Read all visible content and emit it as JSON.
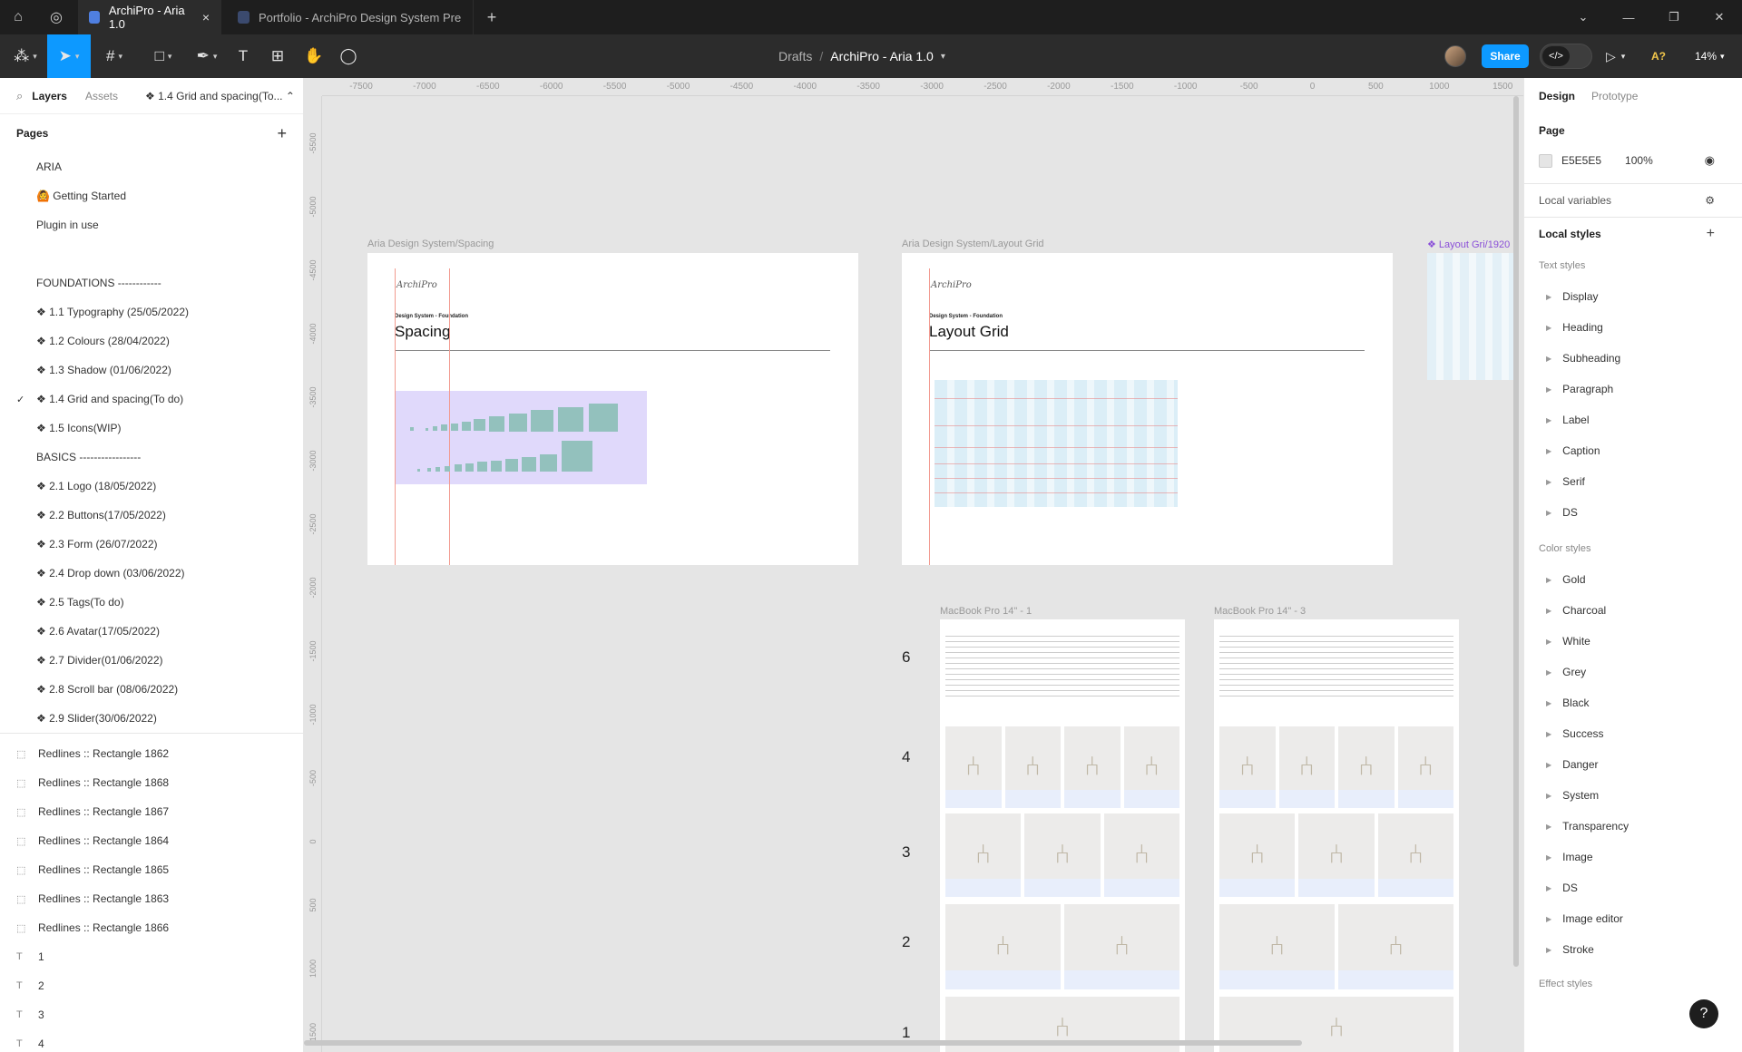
{
  "titlebar": {
    "tabs": [
      {
        "label": "ArchiPro - Aria 1.0",
        "close": "×"
      },
      {
        "label": "Portfolio - ArchiPro Design System Prepar"
      }
    ],
    "new_tab": "+",
    "window": {
      "minimize": "—",
      "maximize": "❐",
      "close": "✕",
      "dropdown": "⌄"
    }
  },
  "toolbar": {
    "breadcrumb": {
      "folder": "Drafts",
      "separator": "/",
      "file": "ArchiPro - Aria 1.0"
    },
    "share_label": "Share",
    "dev_label": "</>",
    "a11y_label": "A?",
    "zoom_label": "14%"
  },
  "left_panel": {
    "tabs": {
      "layers": "Layers",
      "assets": "Assets",
      "current_page": "❖ 1.4 Grid and spacing(To... ⌃"
    },
    "pages_header": "Pages",
    "pages": [
      {
        "label": "ARIA"
      },
      {
        "label": "🙆 Getting Started"
      },
      {
        "label": "Plugin in use"
      },
      {
        "label": ""
      },
      {
        "label": "FOUNDATIONS ------------"
      },
      {
        "label": "❖ 1.1 Typography (25/05/2022)"
      },
      {
        "label": "❖ 1.2 Colours (28/04/2022)"
      },
      {
        "label": "❖ 1.3 Shadow (01/06/2022)"
      },
      {
        "label": "❖ 1.4 Grid and spacing(To do)",
        "checked": "✓"
      },
      {
        "label": "❖ 1.5 Icons(WIP)"
      },
      {
        "label": "BASICS -----------------"
      },
      {
        "label": "❖ 2.1 Logo (18/05/2022)"
      },
      {
        "label": "❖ 2.2 Buttons(17/05/2022)"
      },
      {
        "label": "❖ 2.3 Form (26/07/2022)"
      },
      {
        "label": "❖ 2.4 Drop down (03/06/2022)"
      },
      {
        "label": "❖ 2.5 Tags(To do)"
      },
      {
        "label": "❖ 2.6 Avatar(17/05/2022)"
      },
      {
        "label": "❖ 2.7 Divider(01/06/2022)"
      },
      {
        "label": "❖ 2.8 Scroll bar (08/06/2022)"
      },
      {
        "label": "❖ 2.9 Slider(30/06/2022)"
      }
    ],
    "layers": [
      {
        "label": "Redlines :: Rectangle 1862",
        "icon": "⬚"
      },
      {
        "label": "Redlines :: Rectangle 1868",
        "icon": "⬚"
      },
      {
        "label": "Redlines :: Rectangle 1867",
        "icon": "⬚"
      },
      {
        "label": "Redlines :: Rectangle 1864",
        "icon": "⬚"
      },
      {
        "label": "Redlines :: Rectangle 1865",
        "icon": "⬚"
      },
      {
        "label": "Redlines :: Rectangle 1863",
        "icon": "⬚"
      },
      {
        "label": "Redlines :: Rectangle 1866",
        "icon": "⬚"
      },
      {
        "label": "1",
        "icon": "T"
      },
      {
        "label": "2",
        "icon": "T"
      },
      {
        "label": "3",
        "icon": "T"
      },
      {
        "label": "4",
        "icon": "T"
      }
    ]
  },
  "right_panel": {
    "tabs": {
      "design": "Design",
      "prototype": "Prototype"
    },
    "page_header": "Page",
    "page_fill": {
      "color": "E5E5E5",
      "opacity": "100%"
    },
    "local_variables": "Local variables",
    "local_styles": "Local styles",
    "text_styles_header": "Text styles",
    "text_styles": [
      "Display",
      "Heading",
      "Subheading",
      "Paragraph",
      "Label",
      "Caption",
      "Serif",
      "DS"
    ],
    "color_styles_header": "Color styles",
    "color_styles": [
      "Gold",
      "Charcoal",
      "White",
      "Grey",
      "Black",
      "Success",
      "Danger",
      "System",
      "Transparency",
      "Image",
      "DS",
      "Image editor",
      "Stroke"
    ],
    "effect_styles_header": "Effect styles"
  },
  "canvas": {
    "ruler_top": [
      "-7500",
      "-7000",
      "-6500",
      "-6000",
      "-5500",
      "-5000",
      "-4500",
      "-4000",
      "-3500",
      "-3000",
      "-2500",
      "-2000",
      "-1500",
      "-1000",
      "-500",
      "0",
      "500",
      "1000",
      "1500"
    ],
    "ruler_left": [
      "-5500",
      "-5000",
      "-4500",
      "-4000",
      "-3500",
      "-3000",
      "-2500",
      "-2000",
      "-1500",
      "-1000",
      "-500",
      "0",
      "500",
      "1000",
      "1500"
    ],
    "frames": {
      "spacing": {
        "label": "Aria Design System/Spacing",
        "signature": "ArchiPro",
        "kicker": "Design System - Foundation",
        "title": "Spacing"
      },
      "layout_grid": {
        "label": "Aria Design System/Layout Grid",
        "signature": "ArchiPro",
        "kicker": "Design System - Foundation",
        "title": "Layout Grid"
      },
      "partial_label": "❖ Layout Gri/1920",
      "mbp1_label": "MacBook Pro 14\" - 1",
      "mbp3_label": "MacBook Pro 14\" - 3"
    },
    "row_numbers": [
      "6",
      "4",
      "3",
      "2",
      "1"
    ]
  },
  "help_label": "?"
}
